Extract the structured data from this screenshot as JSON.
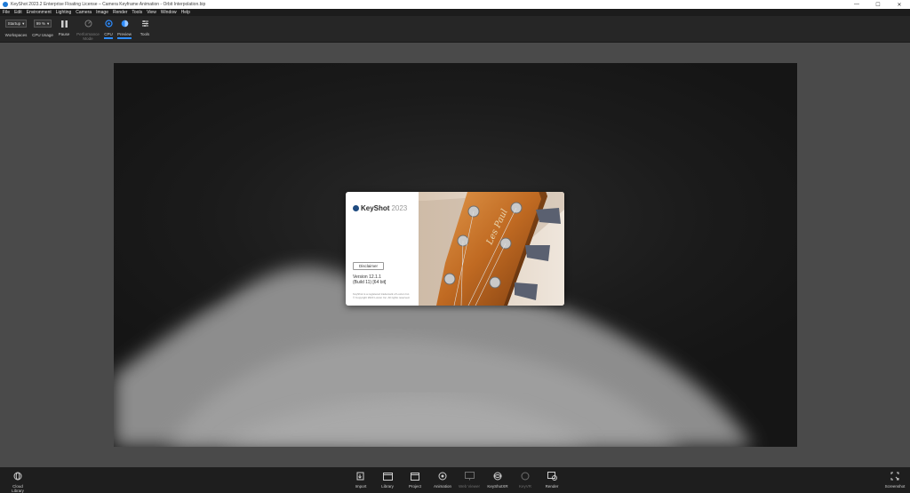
{
  "titlebar": {
    "title": "KeyShot 2023.2 Enterprise Floating License – Camera Keyframe Animation - Orbit Interpolation.bip",
    "minimize": "—",
    "maximize": "☐",
    "close": "✕"
  },
  "menu": [
    "File",
    "Edit",
    "Environment",
    "Lighting",
    "Camera",
    "Image",
    "Render",
    "Tools",
    "View",
    "Window",
    "Help"
  ],
  "ribbon": {
    "workspace_value": "Startup",
    "workspace_label": "Workspaces",
    "cpu_usage_value": "99 %",
    "cpu_usage_label": "CPU Usage",
    "pause_label": "Pause",
    "performance_label": "Performance Mode",
    "cpu_label": "CPU",
    "preview_label": "Preview",
    "tools_label": "Tools"
  },
  "splash": {
    "brand": "KeyShot",
    "year": "2023",
    "disclaimer_button": "Disclaimer",
    "version_line1": "Version 12.1.1",
    "version_line2": "(Build 11) [64 bit]",
    "legal_line1": "KeyShot is a registered trademark of Luxion Inc.",
    "legal_line2": "© Copyright 2023 Luxion Inc. All rights reserved."
  },
  "bottombar": {
    "cloud_library": "Cloud Library",
    "import": "Import",
    "library": "Library",
    "project": "Project",
    "animation": "Animation",
    "keyshotxr": "KeyShotXR",
    "web_viewer": "Web Viewer",
    "keyvr": "KeyVR",
    "render": "Render",
    "screenshot": "Screenshot"
  },
  "colors": {
    "accent": "#2d8cff",
    "ribbon_bg": "#262626",
    "workspace_bg": "#4a4a4a"
  }
}
